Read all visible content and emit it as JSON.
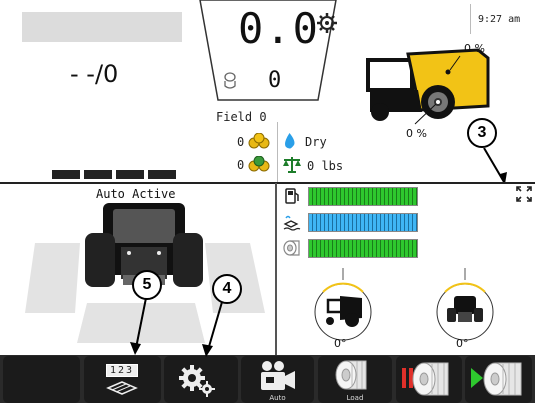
{
  "status": {
    "time": "9:27 am"
  },
  "speed": {
    "value": "0.0",
    "secondary": "0",
    "ratio": "- -/0"
  },
  "combine": {
    "top_pct": "0 %",
    "bottom_pct": "0 %"
  },
  "field": {
    "label": "Field 0",
    "bales": "0",
    "bales2": "0",
    "moisture": "Dry",
    "weight": "0 lbs"
  },
  "guidance": {
    "status": "Auto Active"
  },
  "gauges": [
    {
      "name": "fuel",
      "level": 1.0,
      "color": "#2ec82e"
    },
    {
      "name": "def",
      "level": 1.0,
      "color": "#2aa7ef"
    },
    {
      "name": "net",
      "level": 1.0,
      "color": "#2ec82e"
    }
  ],
  "angles": {
    "pitch": "0°",
    "roll": "0°"
  },
  "toolbar": {
    "auto_label": "Auto",
    "load_label": "Load",
    "counter_label": "123"
  },
  "callouts": {
    "c3": "3",
    "c4": "4",
    "c5": "5"
  }
}
